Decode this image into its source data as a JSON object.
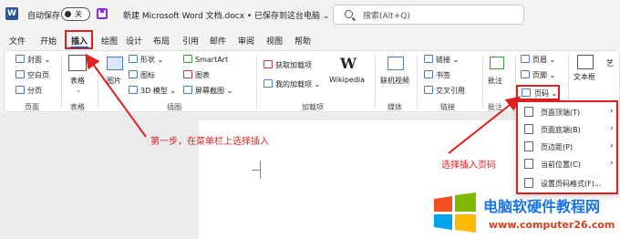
{
  "titlebar": {
    "autosave_label": "自动保存",
    "toggle_state": "关",
    "doc_title": "新建 Microsoft Word 文档.docx • 已保存到这台电脑 ⌄",
    "search_placeholder": "搜索(Alt+Q)"
  },
  "tabs": [
    "文件",
    "开始",
    "插入",
    "绘图",
    "设计",
    "布局",
    "引用",
    "邮件",
    "审阅",
    "视图",
    "帮助"
  ],
  "ribbon": {
    "pages": {
      "cover": "封面 ⌄",
      "blank": "空白页",
      "break": "分页",
      "label": "页面"
    },
    "table": {
      "label": "表格",
      "button": "表格"
    },
    "illustrations": {
      "pictures": "图片",
      "shapes": "形状 ⌄",
      "icons": "图标",
      "model3d": "3D 模型 ⌄",
      "smartart": "SmartArt",
      "chart": "图表",
      "screenshot": "屏幕截图 ⌄",
      "label": "插图"
    },
    "addins": {
      "get": "获取加载项",
      "my": "我的加载项 ⌄",
      "wiki": "Wikipedia",
      "label": "加载项"
    },
    "media": {
      "video": "联机视频",
      "label": "媒体"
    },
    "links": {
      "link": "链接 ⌄",
      "bookmark": "书签",
      "crossref": "交叉引用",
      "label": "链接"
    },
    "comments": {
      "comment": "批注",
      "label": "批注"
    },
    "header_footer": {
      "header": "页眉 ⌄",
      "footer": "页脚 ⌄",
      "page_number": "页码 ⌄"
    },
    "text": {
      "textbox": "文本框",
      "art": "艺"
    }
  },
  "page_number_menu": [
    {
      "label": "页面顶端(T)",
      "arrow": "›"
    },
    {
      "label": "页面底端(B)",
      "arrow": "›"
    },
    {
      "label": "页边距(P)",
      "arrow": "›"
    },
    {
      "label": "当前位置(C)",
      "arrow": "›"
    },
    {
      "label": "设置页码格式(F)...",
      "arrow": ""
    }
  ],
  "annotations": {
    "step1": "第一步，在菜单栏上选择插入",
    "step2": "选择插入页码"
  },
  "watermark": {
    "title": "电脑软硬件教程网",
    "url": "www.computer26.com"
  },
  "colors": {
    "accent": "#2b579a",
    "annotation": "#e02020"
  }
}
